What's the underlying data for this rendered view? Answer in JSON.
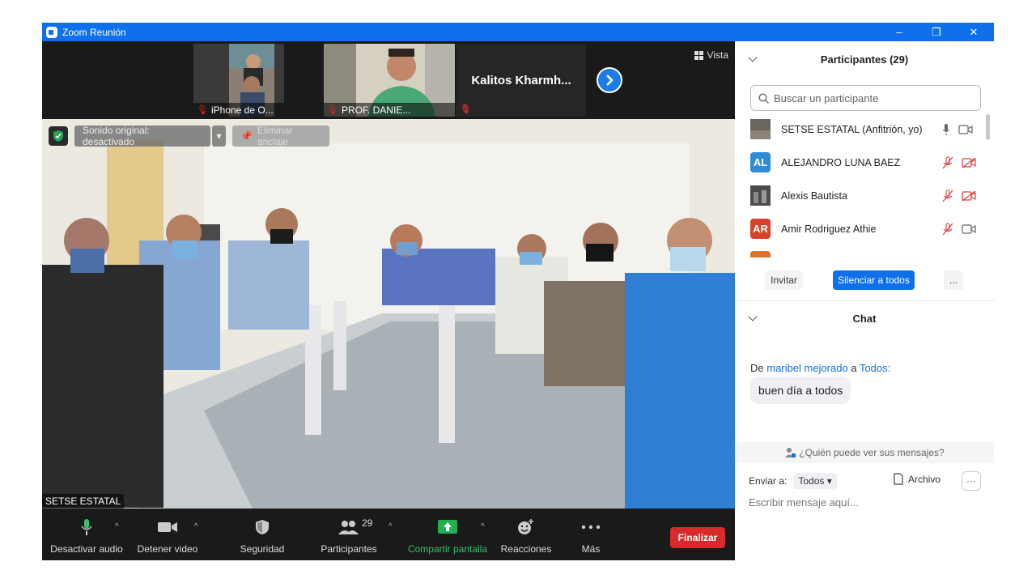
{
  "window": {
    "title": "Zoom Reunión",
    "controls": [
      "–",
      "❐",
      "✕"
    ]
  },
  "strip": {
    "thumbs": [
      {
        "name": "iPhone de O..."
      },
      {
        "name": "PROF. DANIE..."
      }
    ],
    "text_tile": "Kalitos Kharmh...",
    "view_label": "Vista"
  },
  "main_video": {
    "name": "SETSE ESTATAL",
    "audio_btn": "Sonido original: desactivado",
    "unpin_btn": "Eliminar anclaje"
  },
  "toolbar": {
    "audio": "Desactivar audio",
    "video": "Detener video",
    "security": "Seguridad",
    "participants": "Participantes",
    "participants_count": "29",
    "share": "Compartir pantalla",
    "reactions": "Reacciones",
    "more": "Más",
    "end": "Finalizar"
  },
  "participants_panel": {
    "title": "Participantes (29)",
    "search_placeholder": "Buscar un participante",
    "people": [
      {
        "name": "SETSE ESTATAL (Anfitrión, yo)",
        "initials": "",
        "color": "#5a5a5a"
      },
      {
        "name": "ALEJANDRO LUNA BAEZ",
        "initials": "AL",
        "color": "#2d8cd6"
      },
      {
        "name": "Alexis Bautista",
        "initials": "",
        "color": "#555555"
      },
      {
        "name": "Amir Rodriguez Athie",
        "initials": "AR",
        "color": "#d9412a"
      }
    ],
    "invite": "Invitar",
    "mute_all": "Silenciar a todos",
    "more": "..."
  },
  "chat": {
    "title": "Chat",
    "from_prefix": "De",
    "sender": "maribel mejorado",
    "to_word": "a",
    "recipient": "Todos:",
    "message": "buen día a todos",
    "who_sees": "¿Quién puede ver sus mensajes?",
    "send_to_label": "Enviar a:",
    "send_to_value": "Todos",
    "file_label": "Archivo",
    "input_placeholder": "Escribir mensaje aquí..."
  }
}
